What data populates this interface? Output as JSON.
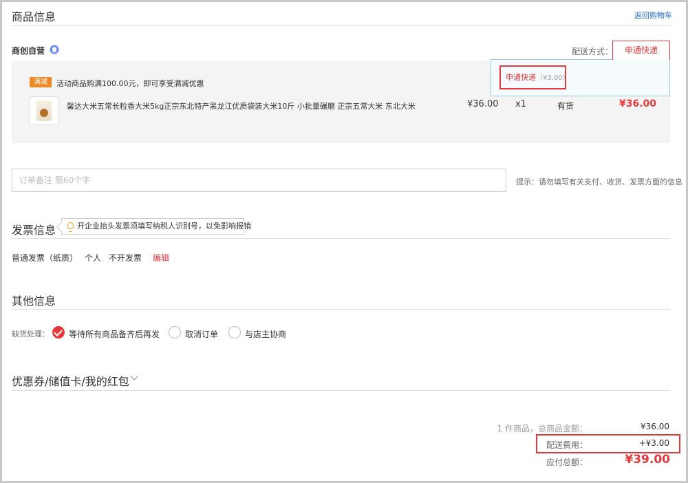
{
  "goods_section": {
    "title": "商品信息",
    "back_to_cart": "返回购物车"
  },
  "shop": {
    "name": "商创自营",
    "icon": "chat-icon"
  },
  "shipping": {
    "label": "配送方式：",
    "selected": "申通快递",
    "options": [
      {
        "name": "申通快递",
        "price": "（¥3.00）"
      }
    ]
  },
  "promo": {
    "badge": "满减",
    "text": "活动商品购满100.00元，即可享受满减优惠"
  },
  "product": {
    "title": "馨达大米五常长粒香大米5kg正宗东北特产黑龙江优质袋装大米10斤 小批量碾磨 正宗五常大米 东北大米",
    "price": "¥36.00",
    "quantity": "x1",
    "stock": "有货",
    "subtotal": "¥36.00"
  },
  "remark": {
    "placeholder": "订单备注 限60个字",
    "value": "",
    "hint": "提示：请勿填写有关支付、收货、发票方面的信息"
  },
  "invoice": {
    "title": "发票信息",
    "tip": "开企业抬头发票须填写纳税人识别号，以免影响报销",
    "type": "普通发票（纸质）",
    "header": "个人",
    "content": "不开发票",
    "edit": "编辑"
  },
  "other": {
    "title": "其他信息",
    "stockout_label": "缺货处理：",
    "options": [
      {
        "label": "等待所有商品备齐后再发",
        "checked": true
      },
      {
        "label": "取消订单",
        "checked": false
      },
      {
        "label": "与店主协商",
        "checked": false
      }
    ]
  },
  "coupons": {
    "title": "优惠券/储值卡/我的红包"
  },
  "summary": {
    "items_label": "1 件商品，总商品金额：",
    "items_value": "¥36.00",
    "shipping_label": "配送费用：",
    "shipping_value": "+¥3.00",
    "total_label": "应付总额：",
    "total_value": "¥39.00"
  },
  "colors": {
    "accent": "#e4393c",
    "link": "#1a66c8",
    "badge": "#f08a24"
  }
}
